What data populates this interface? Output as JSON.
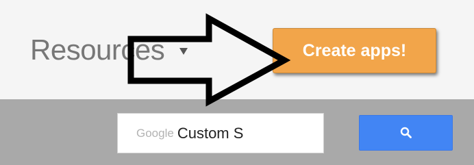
{
  "header": {
    "resources_label": "Resources",
    "create_button_label": "Create apps!"
  },
  "search": {
    "brand": "Google",
    "value": "Custom S"
  },
  "colors": {
    "accent": "#f2a54a",
    "search_button": "#4285f4",
    "header_bg": "#f5f5f5",
    "search_bar_bg": "#a9a9a9"
  },
  "icons": {
    "search_button_icon": "search-icon",
    "menu_caret": "caret-down-icon",
    "annotation": "arrow-right-icon"
  }
}
